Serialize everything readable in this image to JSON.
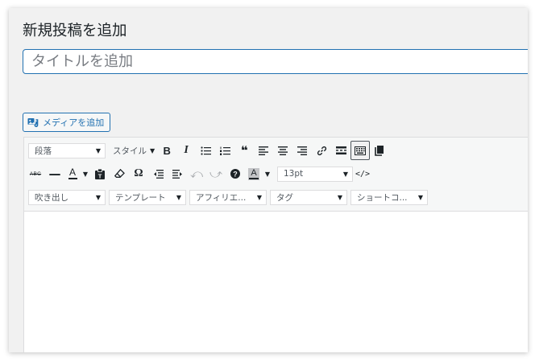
{
  "page_title": "新規投稿を追加",
  "title_input": {
    "placeholder": "タイトルを追加",
    "value": ""
  },
  "media_button": {
    "label": "メディアを追加"
  },
  "toolbar": {
    "format_select": "段落",
    "style_dropdown": "スタイル",
    "font_size_select": "13pt",
    "speech_select": "吹き出し",
    "template_select": "テンプレート",
    "affiliate_select": "アフィリエ...",
    "tag_select": "タグ",
    "shortcode_select": "ショートコ..."
  },
  "colors": {
    "accent": "#2271b1",
    "panel_bg": "#f1f1f1",
    "toolbar_bg": "#f6f7f7"
  },
  "icons": [
    "bold-icon",
    "italic-icon",
    "bullet-list-icon",
    "numbered-list-icon",
    "blockquote-icon",
    "align-left-icon",
    "align-center-icon",
    "align-right-icon",
    "link-icon",
    "read-more-icon",
    "toolbar-toggle-icon",
    "distraction-free-icon",
    "strikethrough-icon",
    "horizontal-rule-icon",
    "text-color-icon",
    "paste-text-icon",
    "clear-formatting-icon",
    "special-character-icon",
    "outdent-icon",
    "indent-icon",
    "undo-icon",
    "redo-icon",
    "help-icon",
    "background-color-icon",
    "code-icon"
  ]
}
